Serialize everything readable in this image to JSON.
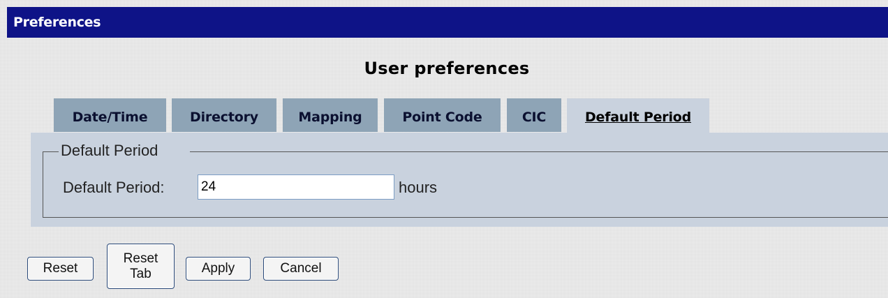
{
  "window": {
    "title": "Preferences",
    "title_bar_color": "#0e1387"
  },
  "page": {
    "heading": "User preferences"
  },
  "tabs": [
    {
      "label": "Date/Time",
      "active": false
    },
    {
      "label": "Directory",
      "active": false
    },
    {
      "label": "Mapping",
      "active": false
    },
    {
      "label": "Point Code",
      "active": false
    },
    {
      "label": "CIC",
      "active": false
    },
    {
      "label": "Default Period",
      "active": true
    }
  ],
  "panel": {
    "group_legend": "Default Period",
    "field_label": "Default Period:",
    "field_value": "24",
    "field_unit": "hours"
  },
  "buttons": {
    "reset": "Reset",
    "reset_tab": "Reset\nTab",
    "apply": "Apply",
    "cancel": "Cancel"
  },
  "colors": {
    "tab_inactive": "#8ea4b6",
    "tab_active": "#c9d2de",
    "panel_bg": "#c9d2de"
  }
}
